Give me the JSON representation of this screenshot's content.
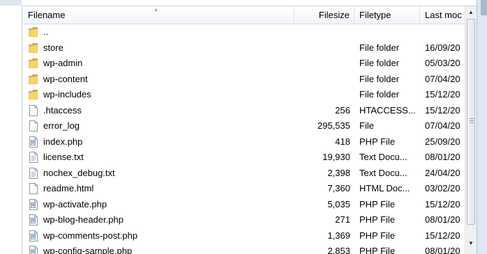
{
  "columns": {
    "filename": "Filename",
    "filesize": "Filesize",
    "filetype": "Filetype",
    "last_modified": "Last moc"
  },
  "files": [
    {
      "name": "..",
      "size": "",
      "type": "",
      "modified": "",
      "icon": "folder-icon"
    },
    {
      "name": "store",
      "size": "",
      "type": "File folder",
      "modified": "16/09/20",
      "icon": "folder-icon"
    },
    {
      "name": "wp-admin",
      "size": "",
      "type": "File folder",
      "modified": "05/03/20",
      "icon": "folder-icon"
    },
    {
      "name": "wp-content",
      "size": "",
      "type": "File folder",
      "modified": "07/04/20",
      "icon": "folder-icon"
    },
    {
      "name": "wp-includes",
      "size": "",
      "type": "File folder",
      "modified": "15/12/20",
      "icon": "folder-icon"
    },
    {
      "name": ".htaccess",
      "size": "256",
      "type": "HTACCESS...",
      "modified": "15/12/20",
      "icon": "blank-file-icon"
    },
    {
      "name": "error_log",
      "size": "295,535",
      "type": "File",
      "modified": "07/04/20",
      "icon": "blank-file-icon"
    },
    {
      "name": "index.php",
      "size": "418",
      "type": "PHP File",
      "modified": "25/09/20",
      "icon": "php-file-icon"
    },
    {
      "name": "license.txt",
      "size": "19,930",
      "type": "Text Docu...",
      "modified": "08/01/20",
      "icon": "text-file-icon"
    },
    {
      "name": "nochex_debug.txt",
      "size": "2,398",
      "type": "Text Docu...",
      "modified": "24/04/20",
      "icon": "text-file-icon"
    },
    {
      "name": "readme.html",
      "size": "7,360",
      "type": "HTML Doc...",
      "modified": "03/02/20",
      "icon": "blank-file-icon"
    },
    {
      "name": "wp-activate.php",
      "size": "5,035",
      "type": "PHP File",
      "modified": "15/12/20",
      "icon": "php-file-icon"
    },
    {
      "name": "wp-blog-header.php",
      "size": "271",
      "type": "PHP File",
      "modified": "08/01/20",
      "icon": "php-file-icon"
    },
    {
      "name": "wp-comments-post.php",
      "size": "1,369",
      "type": "PHP File",
      "modified": "15/12/20",
      "icon": "php-file-icon"
    },
    {
      "name": "wp-config-sample.php",
      "size": "2,853",
      "type": "PHP File",
      "modified": "08/01/20",
      "icon": "php-file-icon"
    }
  ],
  "colors": {
    "folder": "#e9b63f",
    "header_bg": "#f1f4f8",
    "chrome": "#dde6f2"
  }
}
